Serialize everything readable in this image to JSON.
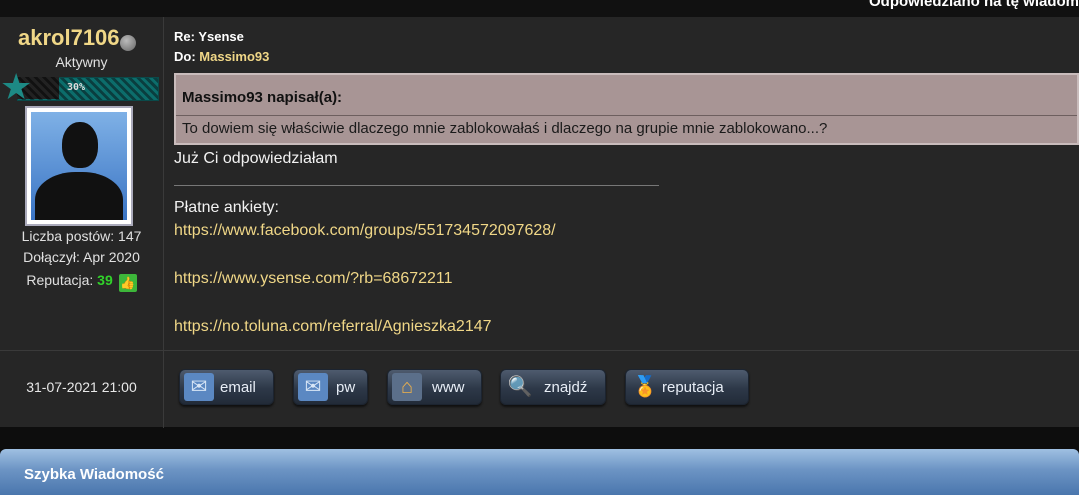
{
  "header": {
    "replied_text": "Odpowiedziano na tę wiadom"
  },
  "author": {
    "username": "akrol7106",
    "rank": "Aktywny",
    "rank_progress_label": "30%",
    "rank_progress": 0.3,
    "posts_label": "Liczba postów: 147",
    "joined_label": "Dołączył: Apr 2020",
    "reputation_label": "Reputacja: ",
    "reputation_value": "39"
  },
  "message": {
    "subject": "Re: Ysense",
    "to_label": "Do: ",
    "to_user": "Massimo93",
    "quote_header": "Massimo93 napisał(a):",
    "quote_text": "To dowiem się właściwie dlaczego mnie zablokowałaś i dlaczego na grupie mnie zablokowano...?",
    "reply": "Już Ci odpowiedziałam"
  },
  "signature": {
    "title": "Płatne ankiety:",
    "links": [
      "https://www.facebook.com/groups/551734572097628/",
      "https://www.ysense.com/?rb=68672211",
      "https://no.toluna.com/referral/Agnieszka2147"
    ]
  },
  "footer": {
    "date": "31-07-2021 21:00",
    "buttons": {
      "email": "email",
      "pw": "pw",
      "www": "www",
      "znajdz": "znajdź",
      "reputacja": "reputacja"
    }
  },
  "quick_reply": {
    "title": "Szybka Wiadomość"
  },
  "icons": {
    "status": "offline-status-icon",
    "rank": "star-icon",
    "avatar": "default-avatar",
    "reputation": "thumbs-up-icon",
    "email": "envelope-icon",
    "pw": "envelope-icon",
    "www": "house-icon",
    "znajdz": "magnifier-icon",
    "reputacja": "medal-icon"
  },
  "colors": {
    "username": "#f0d787",
    "link": "#f0d787",
    "reputation_value": "#31d22a",
    "quote_bg": "#a89595",
    "quick_bar": "#6c94c4"
  }
}
